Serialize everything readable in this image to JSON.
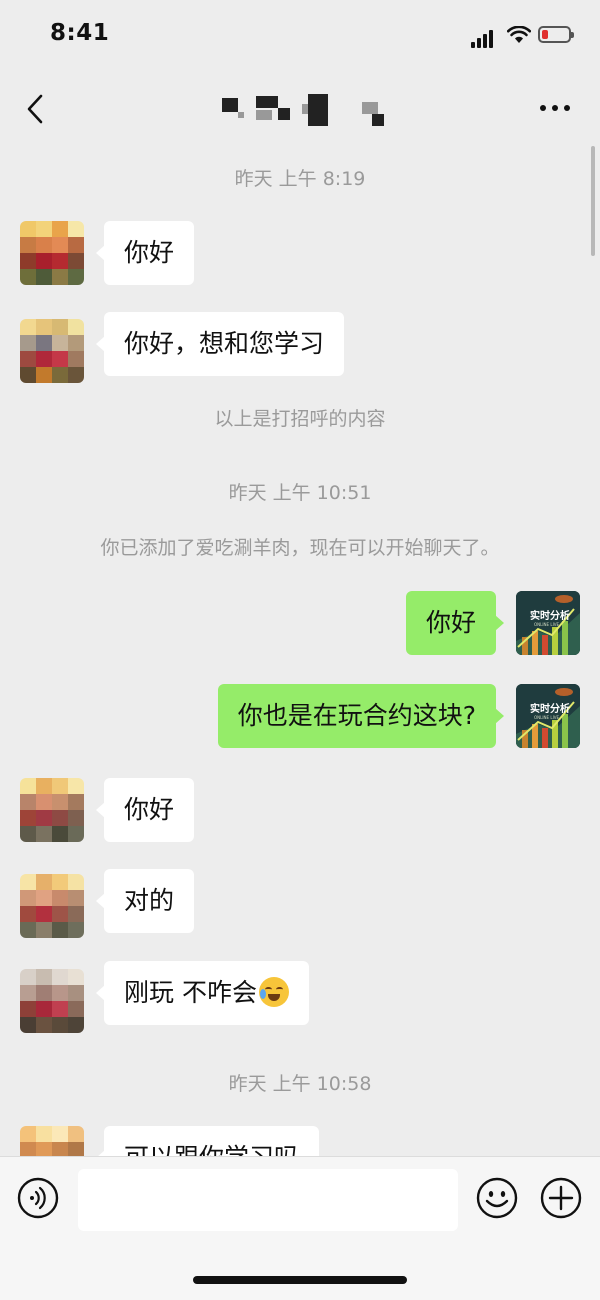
{
  "status_bar": {
    "time": "8:41",
    "battery_color": "#e0302f"
  },
  "nav": {
    "back_icon": "chevron-left-icon",
    "contact_name": "",
    "more_icon": "ellipsis-icon"
  },
  "messages": {
    "ts1": "昨天 上午 8:19",
    "m1": "你好",
    "m2": "你好，想和您学习",
    "notice1": "以上是打招呼的内容",
    "ts2": "昨天 上午 10:51",
    "notice2": "你已添加了爱吃涮羊肉，现在可以开始聊天了。",
    "m3": "你好",
    "m4": "你也是在玩合约这块?",
    "m5": "你好",
    "m6": "对的",
    "m7": "刚玩 不咋会",
    "m7_emoji": "crying-laughing-emoji",
    "ts3": "昨天 上午 10:58",
    "m8": "可以跟你学习吗"
  },
  "my_avatar": {
    "text": "实时分析",
    "sub": "ONLINE LIVE"
  },
  "input_bar": {
    "placeholder": "",
    "voice_icon": "voice-icon",
    "emoji_icon": "smiley-icon",
    "plus_icon": "plus-icon"
  },
  "colors": {
    "background": "#ededed",
    "my_bubble": "#95ec69",
    "their_bubble": "#ffffff",
    "system_text": "#9a9a9a"
  }
}
